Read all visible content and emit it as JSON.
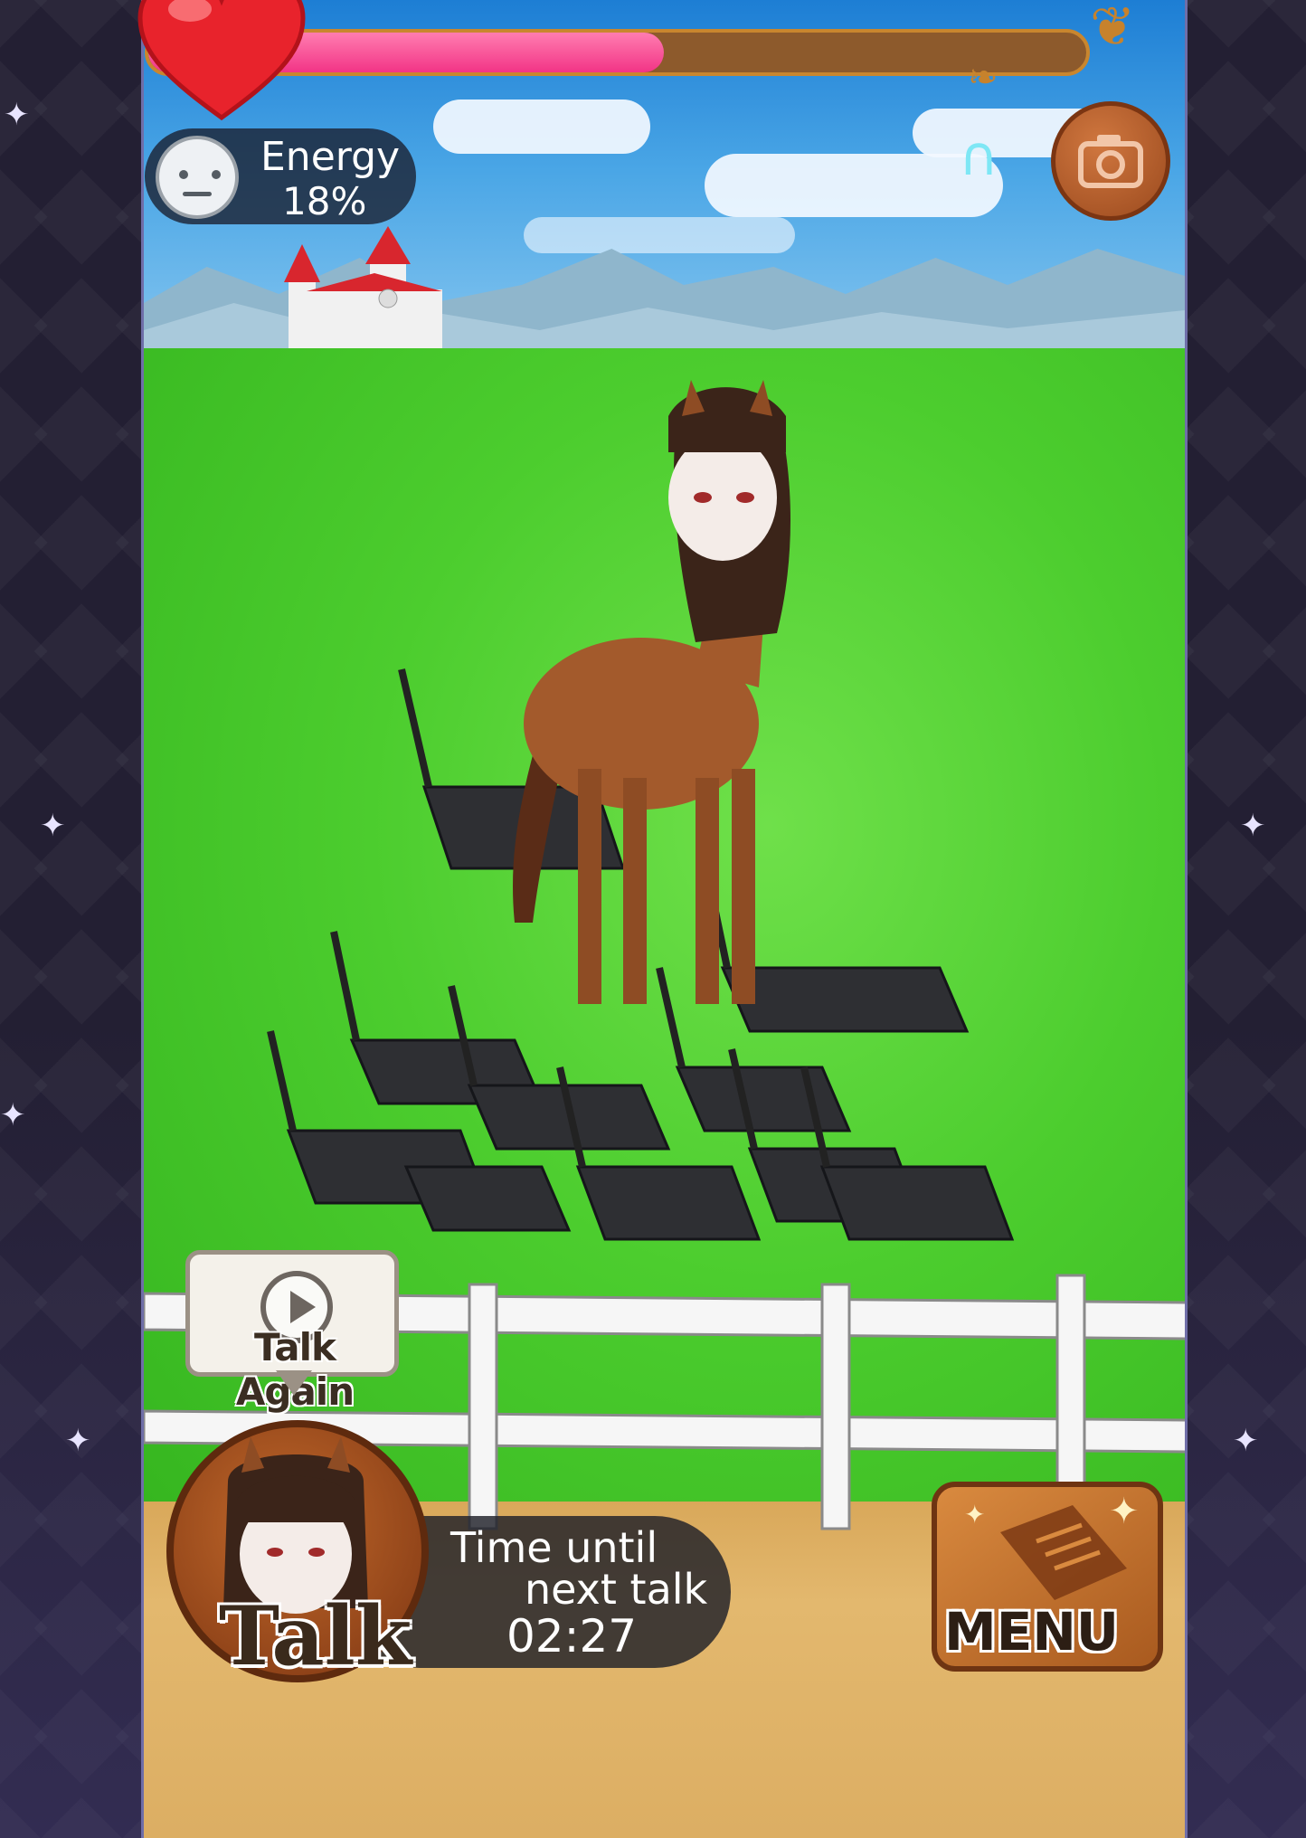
{
  "hud": {
    "affection_fraction": 0.55,
    "energy_label": "Energy",
    "energy_value": "18%"
  },
  "talk_again": {
    "label": "Talk Again"
  },
  "talk": {
    "label": "Talk",
    "timer_line1": "Time until",
    "timer_line2": "next talk",
    "timer_value": "02:27"
  },
  "menu": {
    "label": "MENU"
  },
  "colors": {
    "affection_fill": "#f23486",
    "grass": "#4ccd2e",
    "dirt": "#e3b86e",
    "frame_brown": "#7a4318"
  },
  "icons": [
    "heart-icon",
    "neutral-face-icon",
    "horseshoe-icon",
    "camera-icon",
    "play-icon",
    "menu-book-icon",
    "sparkle-icon"
  ]
}
